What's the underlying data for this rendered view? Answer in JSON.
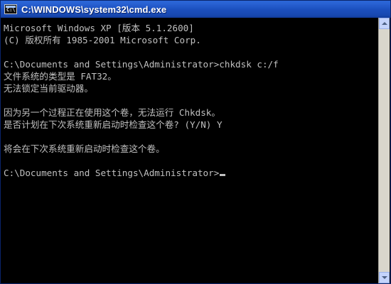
{
  "window": {
    "title": "C:\\WINDOWS\\system32\\cmd.exe",
    "icon_name": "console-icon",
    "icon_text": "C:\\"
  },
  "console": {
    "lines": [
      "Microsoft Windows XP [版本 5.1.2600]",
      "(C) 版权所有 1985-2001 Microsoft Corp.",
      "",
      "C:\\Documents and Settings\\Administrator>chkdsk c:/f",
      "文件系统的类型是 FAT32。",
      "无法锁定当前驱动器。",
      "",
      "因为另一个过程正在使用这个卷，无法运行 Chkdsk。",
      "是否计划在下次系统重新启动时检查这个卷? (Y/N) Y",
      "",
      "将会在下次系统重新启动时检查这个卷。",
      "",
      "C:\\Documents and Settings\\Administrator>"
    ]
  },
  "colors": {
    "text": "#c0c0c0",
    "background": "#000000",
    "titlebar": "#1c50bf"
  }
}
